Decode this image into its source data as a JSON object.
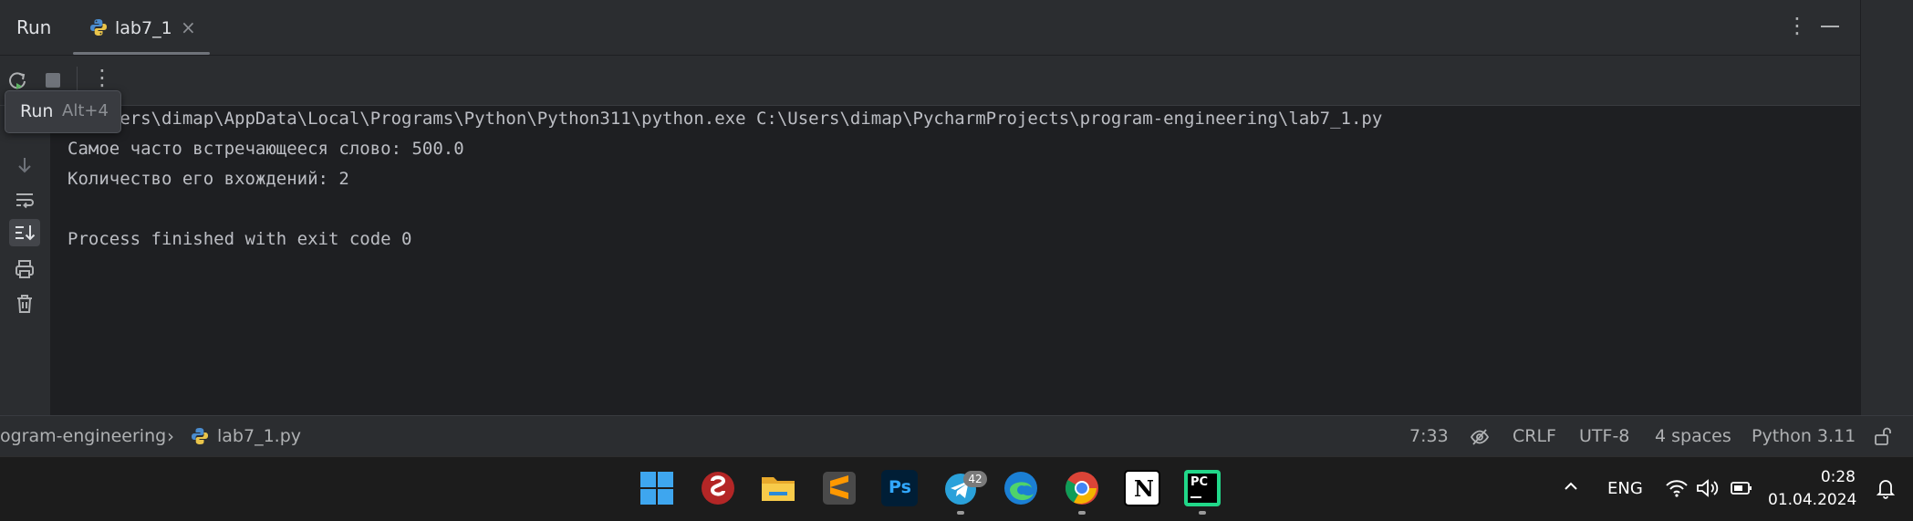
{
  "header": {
    "title": "Run",
    "tab": {
      "label": "lab7_1",
      "close": "×"
    },
    "more": "⋮"
  },
  "toolbar": {
    "more": "⋮"
  },
  "tooltip": {
    "label": "Run",
    "shortcut": "Alt+4"
  },
  "console": {
    "lines": [
      "C:\\Users\\dimap\\AppData\\Local\\Programs\\Python\\Python311\\python.exe C:\\Users\\dimap\\PycharmProjects\\program-engineering\\lab7_1.py",
      "Самое часто встречающееся слово: 500.0",
      "Количество его вхождений: 2",
      "",
      "Process finished with exit code 0"
    ]
  },
  "statusbar": {
    "breadcrumb_project": "ogram-engineering",
    "breadcrumb_chevron": "›",
    "breadcrumb_file": "lab7_1.py",
    "position": "7:33",
    "line_separator": "CRLF",
    "encoding": "UTF-8",
    "indent": "4 spaces",
    "interpreter": "Python 3.11"
  },
  "taskbar": {
    "apps": [
      {
        "name": "start",
        "icon": "windows-start-icon"
      },
      {
        "name": "wireguard",
        "icon": "snake-app-icon"
      },
      {
        "name": "file-explorer",
        "icon": "folder-icon"
      },
      {
        "name": "sublime-text",
        "icon": "sublime-icon"
      },
      {
        "name": "photoshop",
        "icon": "photoshop-icon",
        "label": "Ps"
      },
      {
        "name": "telegram",
        "icon": "telegram-icon",
        "badge": "42"
      },
      {
        "name": "edge",
        "icon": "edge-icon"
      },
      {
        "name": "chrome",
        "icon": "chrome-icon"
      },
      {
        "name": "notion",
        "icon": "notion-icon",
        "label": "N"
      },
      {
        "name": "pycharm",
        "icon": "pycharm-icon",
        "label": "PC"
      }
    ],
    "tray": {
      "language": "ENG",
      "time": "0:28",
      "date": "01.04.2024"
    }
  },
  "colors": {
    "panel_bg": "#2b2d30",
    "editor_bg": "#1e1f22",
    "text": "#bcbec4",
    "taskbar_bg": "#1c1c1c",
    "rerun_green": "#5fb865",
    "pycharm_green": "#21d789"
  }
}
